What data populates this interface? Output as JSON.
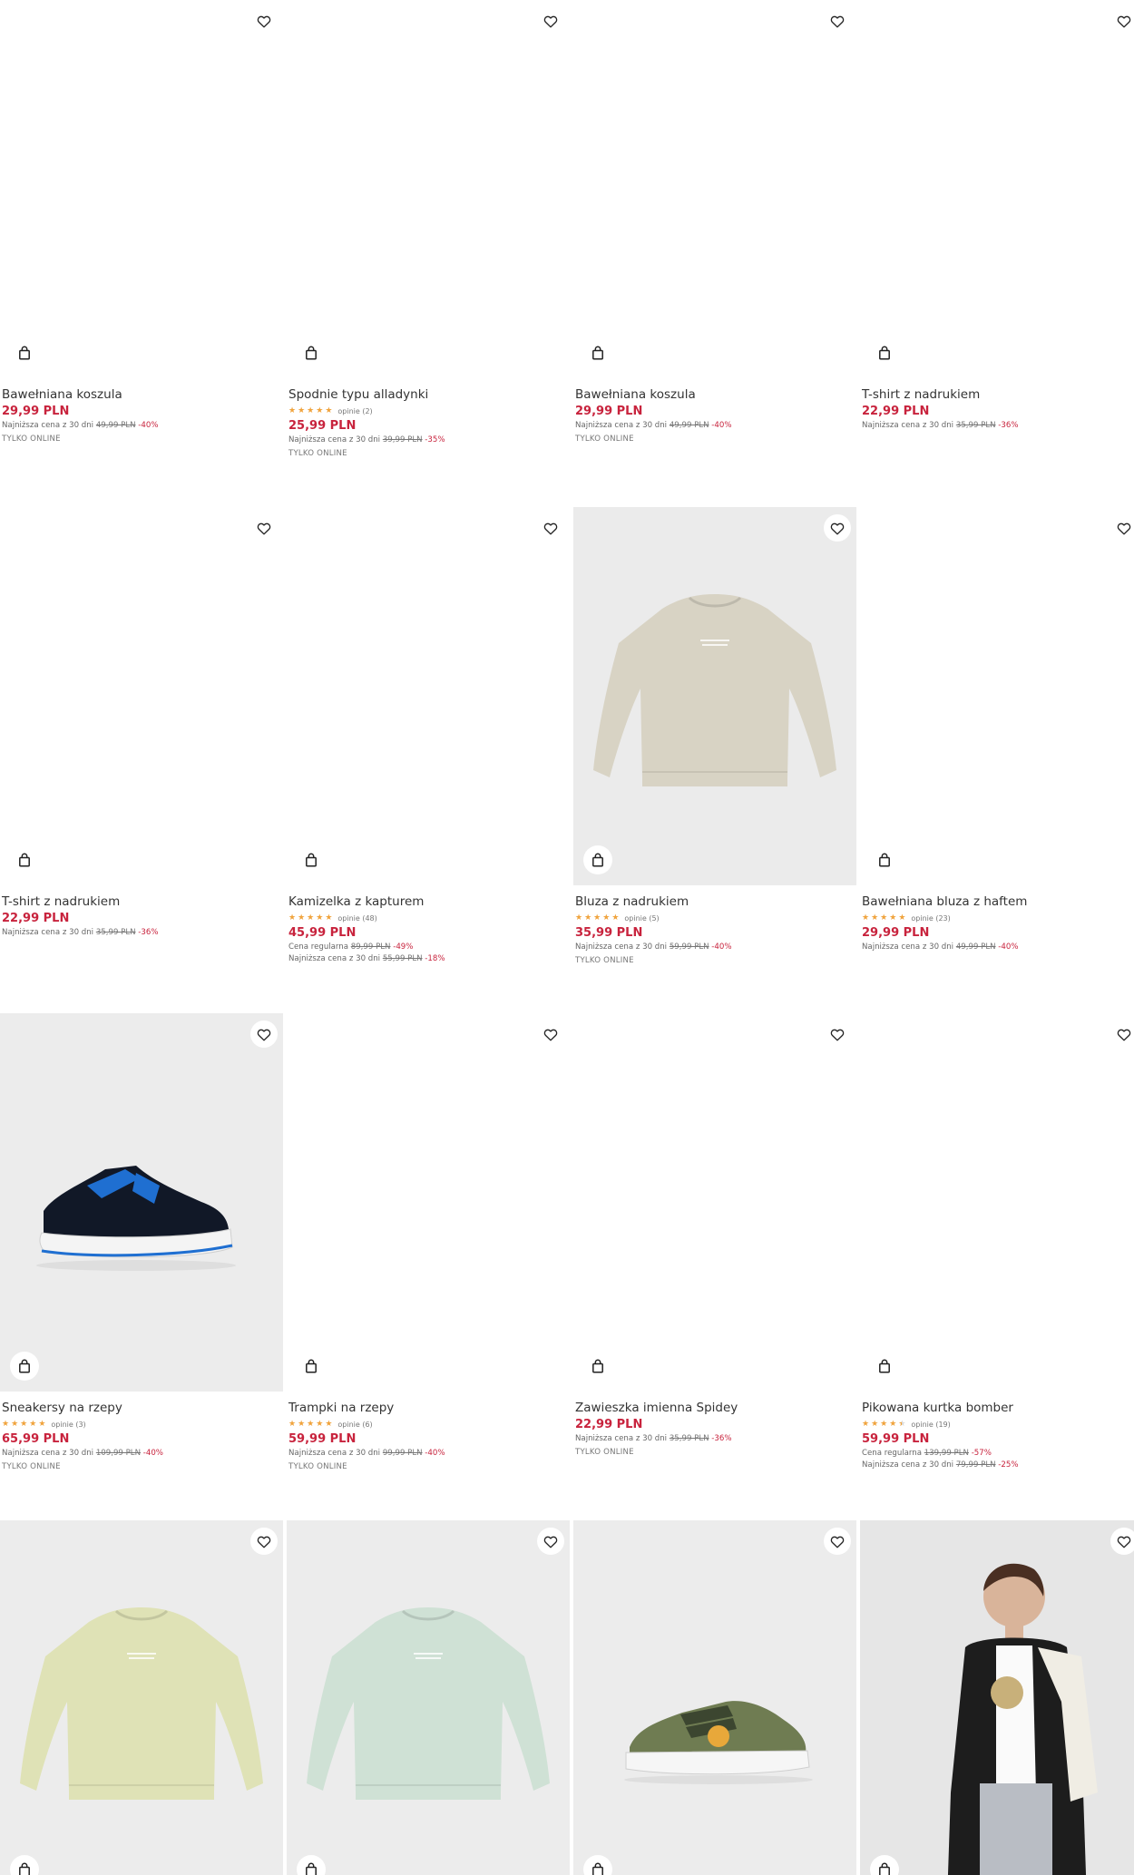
{
  "icons": {
    "wishlist": "heart-outline-icon",
    "cart": "shopping-bag-icon"
  },
  "colors": {
    "price": "#c8233d",
    "star": "#f0a33c"
  },
  "products": [
    {
      "name": "Bawełniana koszula",
      "image": "blank",
      "price": "29,99 PLN",
      "lines": [
        {
          "label": "Najniższa cena z 30 dni",
          "old": "49,99 PLN",
          "discount": "-40%"
        }
      ],
      "online": "TYLKO ONLINE"
    },
    {
      "name": "Spodnie typu alladynki",
      "image": "blank",
      "rating": 5,
      "reviews": "opinie (2)",
      "price": "25,99 PLN",
      "lines": [
        {
          "label": "Najniższa cena z 30 dni",
          "old": "39,99 PLN",
          "discount": "-35%"
        }
      ],
      "online": "TYLKO ONLINE"
    },
    {
      "name": "Bawełniana koszula",
      "image": "blank",
      "price": "29,99 PLN",
      "lines": [
        {
          "label": "Najniższa cena z 30 dni",
          "old": "49,99 PLN",
          "discount": "-40%"
        }
      ],
      "online": "TYLKO ONLINE"
    },
    {
      "name": "T-shirt z nadrukiem",
      "image": "blank",
      "price": "22,99 PLN",
      "lines": [
        {
          "label": "Najniższa cena z 30 dni",
          "old": "35,99 PLN",
          "discount": "-36%"
        }
      ]
    },
    {
      "name": "T-shirt z nadrukiem",
      "image": "blank",
      "price": "22,99 PLN",
      "lines": [
        {
          "label": "Najniższa cena z 30 dni",
          "old": "35,99 PLN",
          "discount": "-36%"
        }
      ]
    },
    {
      "name": "Kamizelka z kapturem",
      "image": "blank",
      "rating": 5,
      "reviews": "opinie (48)",
      "price": "45,99 PLN",
      "lines": [
        {
          "label": "Cena regularna",
          "old": "89,99 PLN",
          "discount": "-49%"
        },
        {
          "label": "Najniższa cena z 30 dni",
          "old": "55,99 PLN",
          "discount": "-18%"
        }
      ]
    },
    {
      "name": "Bluza z nadrukiem",
      "image": "sweatshirt",
      "imageColor": "#d8d3c4",
      "imageBg": "#ebebeb",
      "rating": 5,
      "reviews": "opinie (5)",
      "price": "35,99 PLN",
      "lines": [
        {
          "label": "Najniższa cena z 30 dni",
          "old": "59,99 PLN",
          "discount": "-40%"
        }
      ],
      "online": "TYLKO ONLINE"
    },
    {
      "name": "Bawełniana bluza z haftem",
      "image": "blank",
      "rating": 5,
      "reviews": "opinie (23)",
      "price": "29,99 PLN",
      "lines": [
        {
          "label": "Najniższa cena z 30 dni",
          "old": "49,99 PLN",
          "discount": "-40%"
        }
      ]
    },
    {
      "name": "Sneakersy na rzepy",
      "image": "sneaker",
      "imageBg": "#ececec",
      "rating": 5,
      "reviews": "opinie (3)",
      "price": "65,99 PLN",
      "lines": [
        {
          "label": "Najniższa cena z 30 dni",
          "old": "109,99 PLN",
          "discount": "-40%"
        }
      ],
      "online": "TYLKO ONLINE"
    },
    {
      "name": "Trampki na rzepy",
      "image": "blank",
      "rating": 5,
      "reviews": "opinie (6)",
      "price": "59,99 PLN",
      "lines": [
        {
          "label": "Najniższa cena z 30 dni",
          "old": "99,99 PLN",
          "discount": "-40%"
        }
      ],
      "online": "TYLKO ONLINE"
    },
    {
      "name": "Zawieszka imienna Spidey",
      "image": "blank",
      "price": "22,99 PLN",
      "lines": [
        {
          "label": "Najniższa cena z 30 dni",
          "old": "35,99 PLN",
          "discount": "-36%"
        }
      ],
      "online": "TYLKO ONLINE"
    },
    {
      "name": "Pikowana kurtka bomber",
      "image": "blank",
      "rating": 4.5,
      "reviews": "opinie (19)",
      "price": "59,99 PLN",
      "lines": [
        {
          "label": "Cena regularna",
          "old": "139,99 PLN",
          "discount": "-57%"
        },
        {
          "label": "Najniższa cena z 30 dni",
          "old": "79,99 PLN",
          "discount": "-25%"
        }
      ]
    },
    {
      "image": "sweatshirt",
      "imageColor": "#dfe2b6",
      "imageBg": "#ececec"
    },
    {
      "image": "sweatshirt",
      "imageColor": "#cfe1d5",
      "imageBg": "#ececec"
    },
    {
      "image": "canvas-shoe",
      "imageBg": "#ececec"
    },
    {
      "image": "model",
      "imageBg": "#e6e6e6"
    }
  ]
}
